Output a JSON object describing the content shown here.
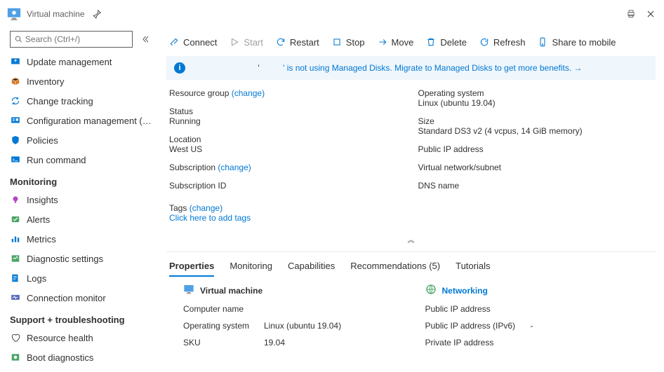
{
  "header": {
    "title": "Virtual machine"
  },
  "search": {
    "placeholder": "Search (Ctrl+/)"
  },
  "sidebar": {
    "items": [
      {
        "label": "Update management"
      },
      {
        "label": "Inventory"
      },
      {
        "label": "Change tracking"
      },
      {
        "label": "Configuration management (…"
      },
      {
        "label": "Policies"
      },
      {
        "label": "Run command"
      }
    ],
    "group_monitoring": "Monitoring",
    "monitoring": [
      {
        "label": "Insights"
      },
      {
        "label": "Alerts"
      },
      {
        "label": "Metrics"
      },
      {
        "label": "Diagnostic settings"
      },
      {
        "label": "Logs"
      },
      {
        "label": "Connection monitor"
      }
    ],
    "group_support": "Support + troubleshooting",
    "support": [
      {
        "label": "Resource health"
      },
      {
        "label": "Boot diagnostics"
      }
    ]
  },
  "toolbar": {
    "connect": "Connect",
    "start": "Start",
    "restart": "Restart",
    "stop": "Stop",
    "move": "Move",
    "delete": "Delete",
    "refresh": "Refresh",
    "share": "Share to mobile"
  },
  "banner": {
    "prefix": "'",
    "text": "' is not using Managed Disks. Migrate to Managed Disks to get more benefits. →"
  },
  "essentials": {
    "left": {
      "resource_group_lbl": "Resource group",
      "change": "(change)",
      "status_lbl": "Status",
      "status_val": "Running",
      "location_lbl": "Location",
      "location_val": "West US",
      "subscription_lbl": "Subscription",
      "subscription_id_lbl": "Subscription ID",
      "tags_lbl": "Tags",
      "tags_add": "Click here to add tags"
    },
    "right": {
      "os_lbl": "Operating system",
      "os_val": "Linux (ubuntu 19.04)",
      "size_lbl": "Size",
      "size_val": "Standard DS3 v2 (4 vcpus, 14 GiB memory)",
      "pip_lbl": "Public IP address",
      "vnet_lbl": "Virtual network/subnet",
      "dns_lbl": "DNS name"
    }
  },
  "tabs": {
    "properties": "Properties",
    "monitoring": "Monitoring",
    "capabilities": "Capabilities",
    "recommendations": "Recommendations (5)",
    "tutorials": "Tutorials"
  },
  "props": {
    "vm_head": "Virtual machine",
    "computer_name_lbl": "Computer name",
    "os_lbl": "Operating system",
    "os_val": "Linux (ubuntu 19.04)",
    "sku_lbl": "SKU",
    "sku_val": "19.04",
    "net_head": "Networking",
    "pip_lbl": "Public IP address",
    "pip6_lbl": "Public IP address (IPv6)",
    "pip6_val": "-",
    "priv_lbl": "Private IP address"
  }
}
